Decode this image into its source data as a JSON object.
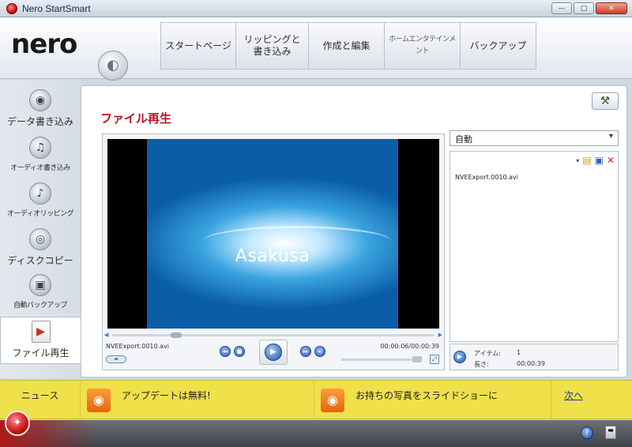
{
  "window": {
    "title": "Nero StartSmart",
    "controls": {
      "minimize": "—",
      "maximize": "□",
      "close": "✕"
    }
  },
  "header": {
    "logo": "nero",
    "tabs": [
      {
        "label": "スタートページ"
      },
      {
        "label": "リッピングと 書き込み"
      },
      {
        "label": "作成と編集"
      },
      {
        "label": "ホームエンタテインメント"
      },
      {
        "label": "バックアップ"
      }
    ]
  },
  "sidebar": {
    "items": [
      {
        "label": "データ書き込み",
        "icon": "disc-icon"
      },
      {
        "label": "オーディオ書き込み",
        "icon": "music-note-icon"
      },
      {
        "label": "オーディオリッピング",
        "icon": "audio-rip-icon"
      },
      {
        "label": "ディスクコピー",
        "icon": "disc-copy-icon"
      },
      {
        "label": "自動バックアップ",
        "icon": "backup-icon"
      },
      {
        "label": "ファイル再生",
        "icon": "play-file-icon"
      }
    ]
  },
  "main": {
    "title": "ファイル再生",
    "player": {
      "video_caption": "Asakusa",
      "file_name": "NVEExport.0010.avi",
      "time": "00:00:06/00:00:39"
    },
    "playlist": {
      "mode": "自動",
      "items": [
        "NVEExport.0010.avi"
      ],
      "items_label": "アイテム:",
      "items_count": "1",
      "length_label": "長さ:",
      "length": "00:00:39"
    }
  },
  "news": {
    "label": "ニュース",
    "items": [
      {
        "text": "アップデートは無料!"
      },
      {
        "text": "お持ちの写真をスライドショーに"
      }
    ],
    "next": "次へ"
  },
  "colors": {
    "accent_red": "#b8141e",
    "news_yellow": "#f0e04a",
    "rss_orange": "#e2660b"
  }
}
